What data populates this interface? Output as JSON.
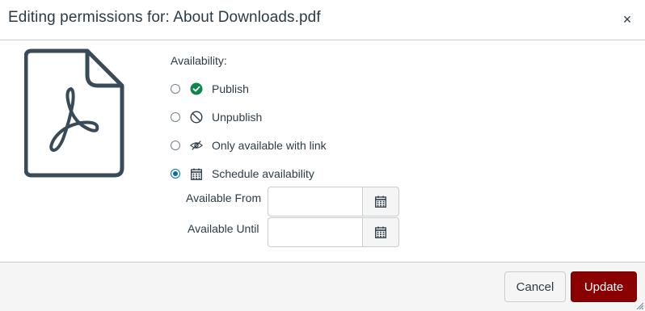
{
  "dialog": {
    "title": "Editing permissions for: About Downloads.pdf",
    "close_glyph": "×"
  },
  "file": {
    "icon": "pdf-file-icon"
  },
  "availability": {
    "label": "Availability:",
    "selected": "schedule",
    "options": [
      {
        "key": "publish",
        "label": "Publish",
        "icon": "published-check-icon",
        "checked": false,
        "icon_color": "#0b874b"
      },
      {
        "key": "unpublish",
        "label": "Unpublish",
        "icon": "unpublished-icon",
        "checked": false
      },
      {
        "key": "link",
        "label": "Only available with link",
        "icon": "eye-off-icon",
        "checked": false
      },
      {
        "key": "schedule",
        "label": "Schedule availability",
        "icon": "calendar-icon",
        "checked": true
      }
    ]
  },
  "schedule": {
    "from": {
      "label": "Available From",
      "value": "",
      "button_icon": "calendar-icon"
    },
    "until": {
      "label": "Available Until",
      "value": "",
      "button_icon": "calendar-icon"
    }
  },
  "footer": {
    "cancel_label": "Cancel",
    "update_label": "Update",
    "update_color": "#8b0000"
  },
  "colors": {
    "text": "#2d3b45",
    "radio_selected": "#0770a3",
    "border": "#c7cdd1",
    "footer_bg": "#f5f5f5"
  }
}
